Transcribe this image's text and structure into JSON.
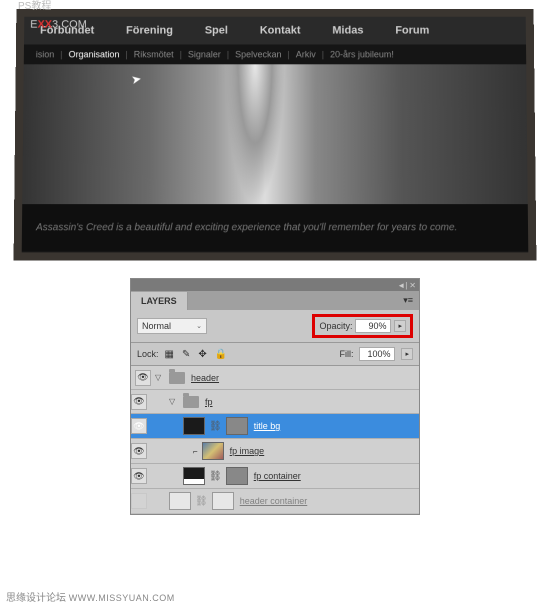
{
  "watermark_chinese": "PS教程",
  "watermark_site": {
    "pre": "E",
    "xx": "XX",
    "post": "3.COM"
  },
  "browser": {
    "nav_primary": [
      "Förbundet",
      "Förening",
      "Spel",
      "Kontakt",
      "Midas",
      "Forum"
    ],
    "nav_secondary": [
      "ision",
      "Organisation",
      "Riksmötet",
      "Signaler",
      "Spelveckan",
      "Arkiv",
      "20-års jubileum!"
    ],
    "caption": "Assassin's Creed is a beautiful and exciting experience that you'll remember for years to come."
  },
  "layers_panel": {
    "tab": "LAYERS",
    "blend_mode": "Normal",
    "opacity_label": "Opacity:",
    "opacity_value": "90%",
    "lock_label": "Lock:",
    "fill_label": "Fill:",
    "fill_value": "100%",
    "layers": [
      {
        "name": "header",
        "type": "group",
        "indent": 1
      },
      {
        "name": "fp",
        "type": "group",
        "indent": 2
      },
      {
        "name": "title bg",
        "type": "selected",
        "indent": 3
      },
      {
        "name": "fp image",
        "type": "image",
        "indent": 4
      },
      {
        "name": "fp container",
        "type": "shape",
        "indent": 3
      },
      {
        "name": "header container",
        "type": "shape-dim",
        "indent": 2
      }
    ]
  },
  "footer_watermark": {
    "chinese": "思缘设计论坛",
    "url": "WWW.MISSYUAN.COM"
  }
}
